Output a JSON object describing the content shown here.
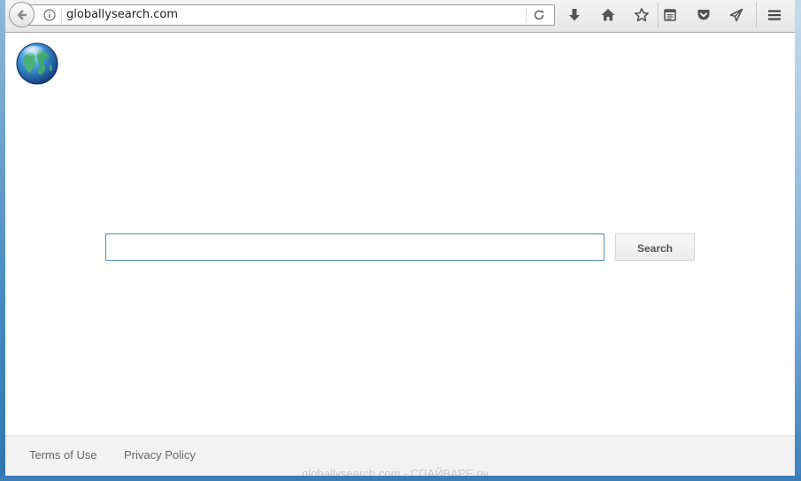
{
  "browser": {
    "url": "globallysearch.com",
    "icons": {
      "back": "back-arrow-icon",
      "info": "info-icon",
      "reload": "reload-icon",
      "download": "download-icon",
      "home": "home-icon",
      "bookmark": "star-icon",
      "reading_list": "reading-list-icon",
      "pocket": "pocket-icon",
      "send": "send-tab-icon",
      "menu": "hamburger-menu-icon"
    }
  },
  "page": {
    "logo": "globe-icon",
    "search": {
      "value": "",
      "placeholder": ""
    },
    "search_button_label": "Search",
    "footer": {
      "terms": "Terms of Use",
      "privacy": "Privacy Policy"
    },
    "watermark": "globallysearch.com - СПАЙВАРЕ.ру"
  },
  "colors": {
    "input_border": "#5c92c8",
    "footer_bg": "#f2f2f2",
    "desktop_blue": "#2a6fa8"
  }
}
